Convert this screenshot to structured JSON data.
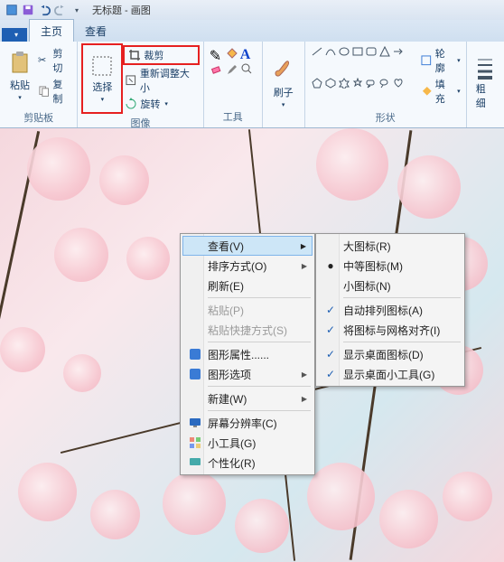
{
  "title": "无标题 - 画图",
  "tabs": {
    "file": "",
    "home": "主页",
    "view": "查看"
  },
  "groups": {
    "clipboard": {
      "label": "剪贴板",
      "paste": "粘贴",
      "cut": "剪切",
      "copy": "复制"
    },
    "image": {
      "label": "图像",
      "select": "选择",
      "crop": "裁剪",
      "resize": "重新调整大小",
      "rotate": "旋转"
    },
    "tools": {
      "label": "工具"
    },
    "brush": {
      "label": "刷子"
    },
    "shapes": {
      "label": "形状",
      "outline": "轮廓",
      "fill": "填充"
    },
    "size": {
      "label": "粗细"
    }
  },
  "ctx1": {
    "view": "查看(V)",
    "sort": "排序方式(O)",
    "refresh": "刷新(E)",
    "paste": "粘贴(P)",
    "paste_shortcut": "粘贴快捷方式(S)",
    "gfx_props": "图形属性......",
    "gfx_opts": "图形选项",
    "new": "新建(W)",
    "resolution": "屏幕分辨率(C)",
    "gadgets": "小工具(G)",
    "personalize": "个性化(R)"
  },
  "ctx2": {
    "large": "大图标(R)",
    "medium": "中等图标(M)",
    "small": "小图标(N)",
    "auto": "自动排列图标(A)",
    "align": "将图标与网格对齐(I)",
    "show_desktop": "显示桌面图标(D)",
    "show_gadgets": "显示桌面小工具(G)"
  }
}
